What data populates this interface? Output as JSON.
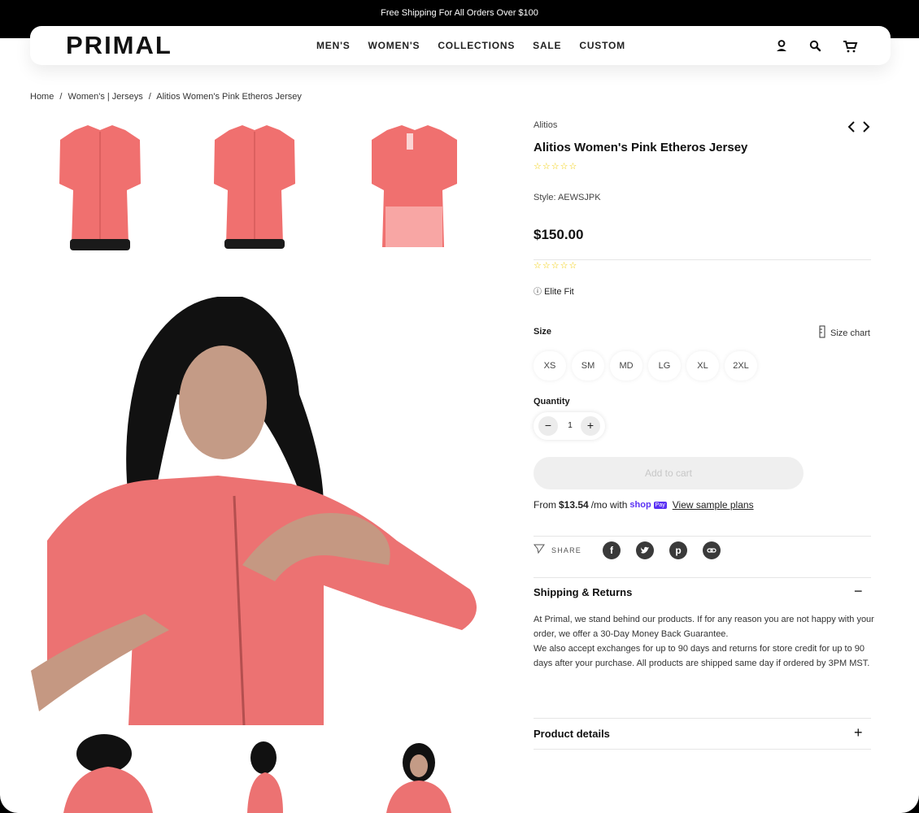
{
  "announcement": "Free Shipping For All Orders Over $100",
  "header": {
    "logo": "PRIMAL",
    "nav": [
      "MEN'S",
      "WOMEN'S",
      "COLLECTIONS",
      "SALE",
      "CUSTOM"
    ],
    "icons": [
      "account-icon",
      "search-icon",
      "cart-icon"
    ]
  },
  "breadcrumb": [
    "Home",
    "Women's | Jerseys",
    "Alitios Women's Pink Etheros Jersey"
  ],
  "breadcrumb_sep": "/",
  "product": {
    "brand": "Alitios",
    "title": "Alitios Women's Pink Etheros Jersey",
    "stars": "☆☆☆☆☆",
    "style": "Style: AEWSJPK",
    "price": "$150.00",
    "fit": "Elite Fit",
    "size_label": "Size",
    "size_chart": "Size chart",
    "sizes": [
      "XS",
      "SM",
      "MD",
      "LG",
      "XL",
      "2XL"
    ],
    "quantity_label": "Quantity",
    "quantity": "1",
    "add_to_cart": "Add to cart",
    "installment_prefix": "From",
    "installment_amount": "$13.54",
    "installment_suffix": "/mo with",
    "shop_pay_word": "shop",
    "shop_pay_badge": "Pay",
    "view_plans": "View sample plans",
    "share_label": "SHARE",
    "share_icons": [
      "facebook-icon",
      "twitter-icon",
      "pinterest-icon",
      "link-icon"
    ],
    "shipping_title": "Shipping & Returns",
    "shipping_text_1": "At Primal, we stand behind our products. If for any reason you are not happy with your order, we offer a 30-Day Money Back Guarantee.",
    "shipping_text_2": "We also accept exchanges for up to 90 days and returns for store credit for up to 90 days after your purchase. All products are shipped same day if ordered by 3PM MST.",
    "details_title": "Product details"
  },
  "colors": {
    "jersey": "#f0706f",
    "shoppay": "#5a31f4",
    "stars": "#f1cc00"
  }
}
